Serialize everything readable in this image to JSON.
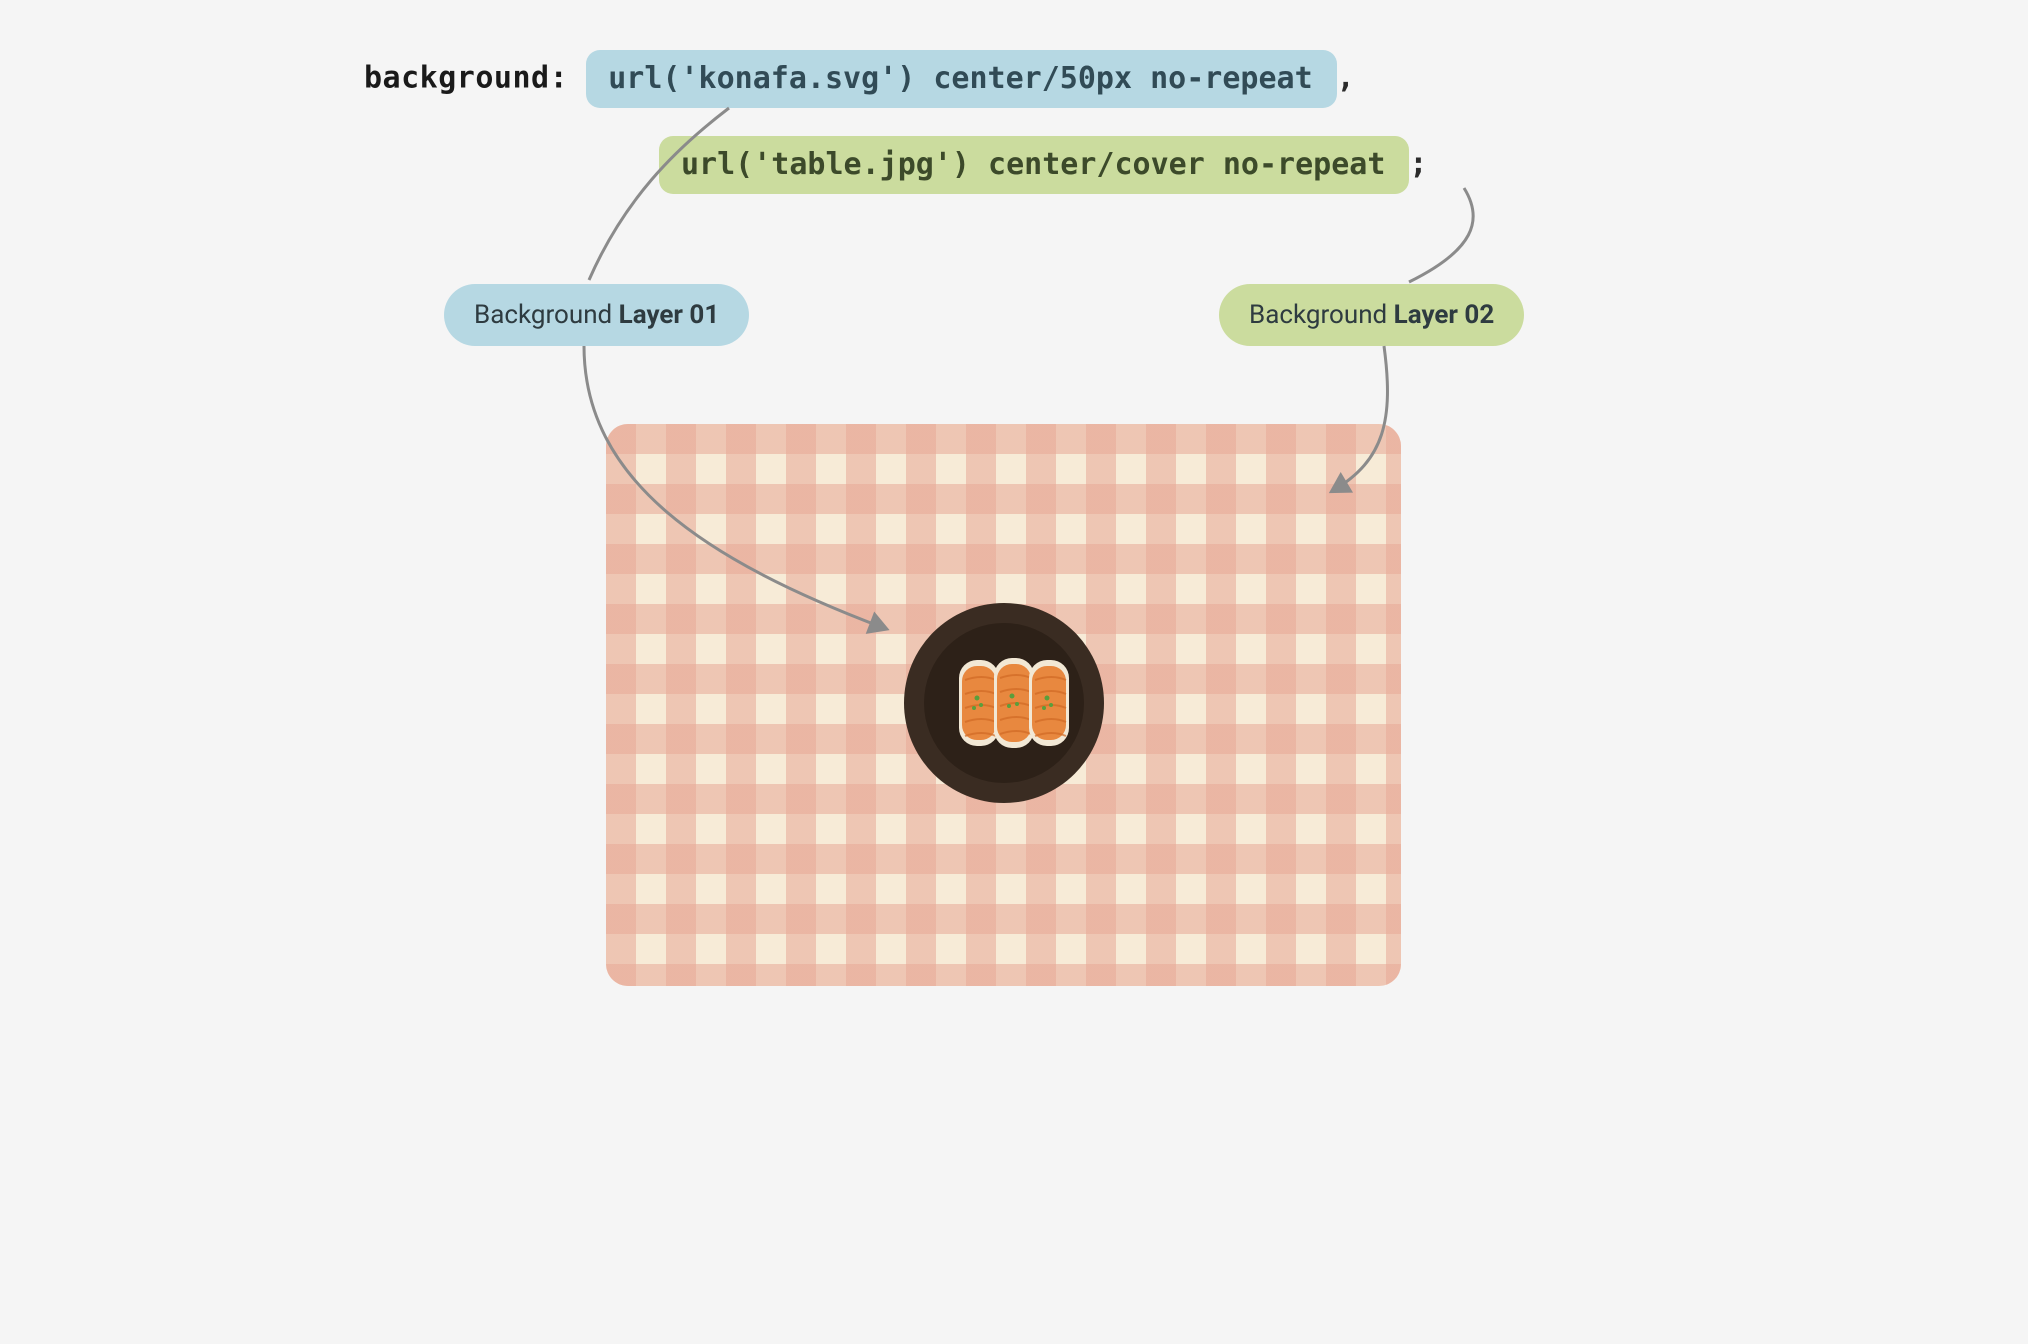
{
  "code": {
    "property": "background:",
    "line1": "url('konafa.svg') center/50px no-repeat",
    "comma": ",",
    "line2": "url('table.jpg') center/cover no-repeat",
    "semicolon": ";"
  },
  "labels": {
    "layer1_prefix": "Background ",
    "layer1_bold": "Layer 01",
    "layer2_prefix": "Background ",
    "layer2_bold": "Layer 02"
  },
  "arrows": {
    "stroke": "#8b8b8b"
  }
}
